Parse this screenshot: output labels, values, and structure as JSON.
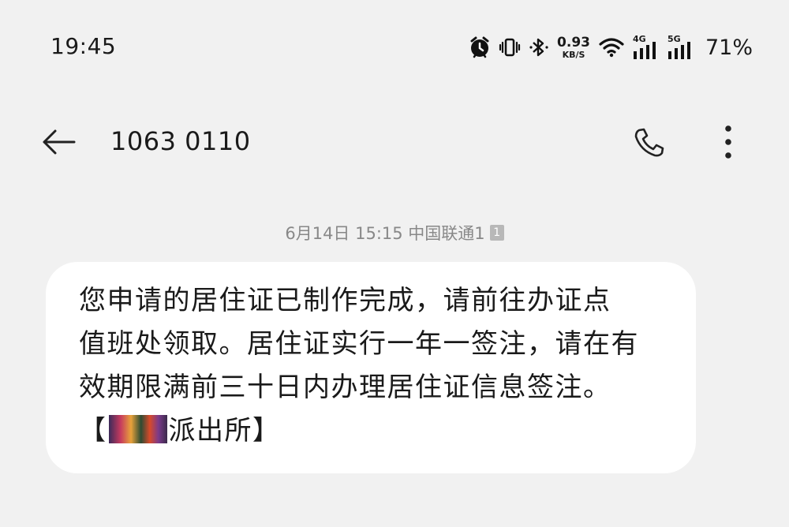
{
  "status_bar": {
    "time": "19:45",
    "net_speed_value": "0.93",
    "net_speed_unit": "KB/S",
    "signal_1_label": "4G",
    "signal_2_label": "5G",
    "battery": "71%",
    "icons": [
      "alarm-icon",
      "vibrate-icon",
      "bluetooth-icon",
      "wifi-icon",
      "signal-icon",
      "signal-icon"
    ]
  },
  "header": {
    "contact": "1063 0110",
    "icons": [
      "back-arrow-icon",
      "phone-icon",
      "more-vertical-icon"
    ]
  },
  "message": {
    "meta": "6月14日 15:15 中国联通1",
    "sim_badge": "1",
    "lines": [
      "您申请的居住证已制作完成，请前往办证点",
      "值班处领取。居住证实行一年一签注，请在有",
      "效期限满前三十日内办理居住证信息签注。"
    ],
    "signature_prefix": "【",
    "signature_suffix": "派出所】"
  },
  "colors": {
    "background": "#f1f1f1",
    "bubble": "#ffffff",
    "meta_text": "#888888",
    "text": "#1a1a1a"
  }
}
